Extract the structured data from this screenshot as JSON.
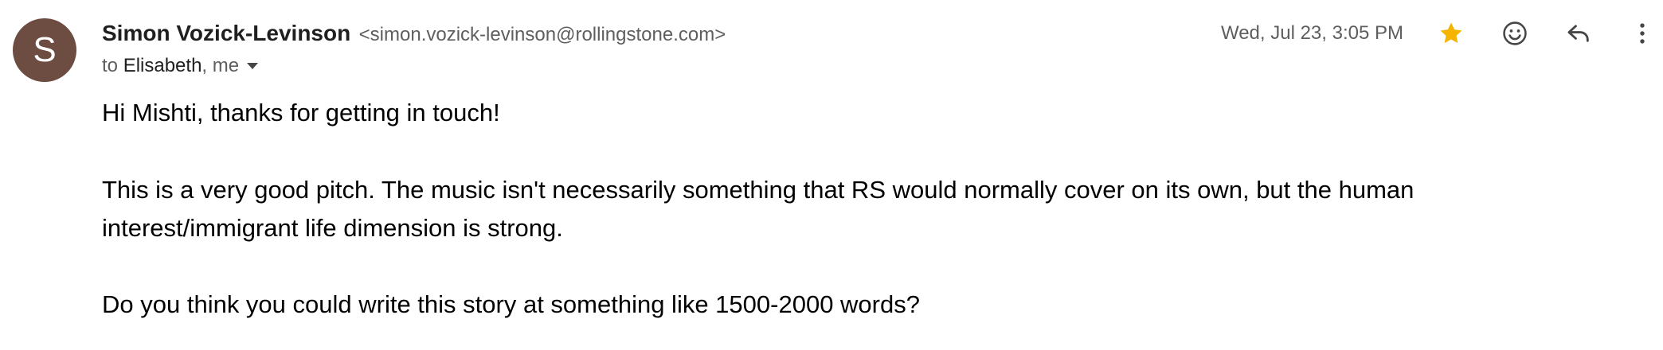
{
  "sender": {
    "avatar_letter": "S",
    "avatar_color": "#6d4c41",
    "name": "Simon Vozick-Levinson",
    "email": "<simon.vozick-levinson@rollingstone.com>"
  },
  "recipients": {
    "prefix": "to",
    "recipient": "Elisabeth",
    "rest": ", me"
  },
  "date": "Wed, Jul 23, 3:05 PM",
  "icons": {
    "star": "star-icon",
    "star_color": "#f4b400",
    "emoji": "emoji-icon",
    "reply": "reply-icon",
    "more": "more-vertical-icon"
  },
  "body": {
    "greeting": "Hi Mishti, thanks for getting in touch!",
    "paragraph1": "This is a very good pitch. The music isn't necessarily something that RS would normally cover on its own, but the human interest/immigrant life dimension is strong.",
    "paragraph2": "Do you think you could write this story at something like 1500-2000 words?"
  }
}
